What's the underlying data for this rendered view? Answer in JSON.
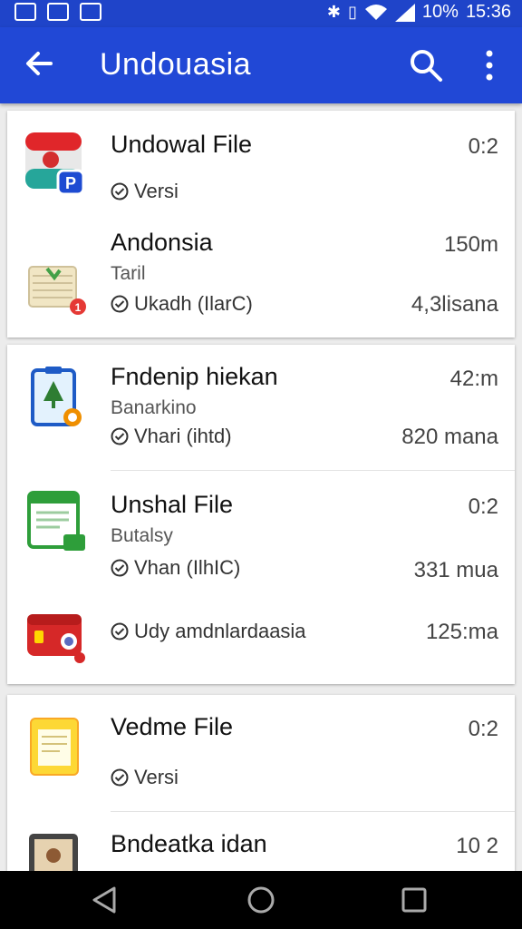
{
  "status_bar": {
    "battery": "10%",
    "time": "15:36"
  },
  "app_bar": {
    "title": "Undouasia"
  },
  "cards": [
    {
      "items": [
        {
          "name": "Undowal File",
          "version": "Versi",
          "right_top": "0:2"
        },
        {
          "name": "Andonsia",
          "subtitle": "Taril",
          "version": "Ukadh (IlarC)",
          "right_top": "150m",
          "right_bottom": "4,3lisana"
        }
      ]
    },
    {
      "items": [
        {
          "name": "Fndenip hiekan",
          "subtitle": "Banarkino",
          "version": "Vhari (ihtd)",
          "right_top": "42:m",
          "right_bottom": "820 mana"
        },
        {
          "name": "Unshal File",
          "subtitle": "Butalsy",
          "version": "Vhan (IlhIC)",
          "right_top": "0:2",
          "right_bottom": "331 mua"
        },
        {
          "version": "Udy amdnlardaasia",
          "right_bottom": "125:ma"
        }
      ]
    },
    {
      "items": [
        {
          "name": "Vedme File",
          "version": "Versi",
          "right_top": "0:2"
        },
        {
          "name": "Bndeatka idan",
          "right_top": "10 2"
        }
      ]
    }
  ],
  "colors": {
    "app_bar": "#2148d6",
    "status_bar": "#1f44c9",
    "background": "#ececec"
  }
}
